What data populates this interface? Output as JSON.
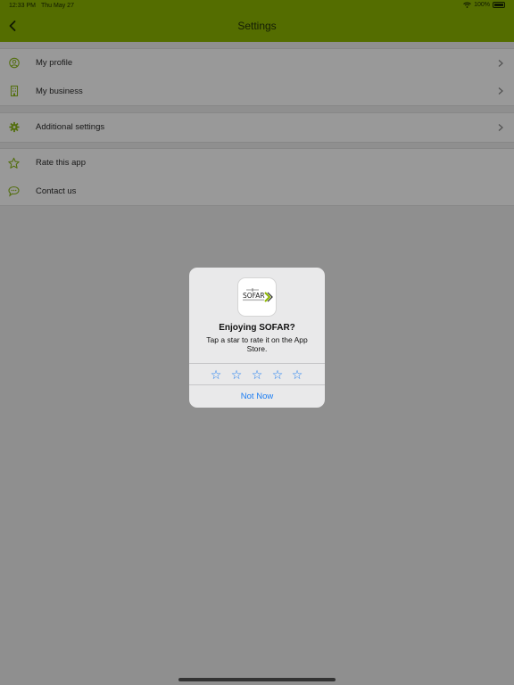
{
  "status_bar": {
    "time": "12:33 PM",
    "date": "Thu May 27",
    "battery": "100%",
    "wifi_icon": "wifi-icon",
    "battery_icon": "battery-icon"
  },
  "nav": {
    "title": "Settings",
    "back_icon": "chevron-left-icon"
  },
  "colors": {
    "brand_green": "#8db600",
    "alert_blue": "#1a7cf2",
    "icon_green": "#8cb91a"
  },
  "settings": {
    "group1": [
      {
        "label": "My profile",
        "icon": "user-circle-icon"
      },
      {
        "label": "My business",
        "icon": "building-icon"
      }
    ],
    "group2": [
      {
        "label": "Additional settings",
        "icon": "gear-icon"
      }
    ],
    "group3": [
      {
        "label": "Rate this app",
        "icon": "star-icon"
      },
      {
        "label": "Contact us",
        "icon": "chat-bubble-icon"
      }
    ]
  },
  "rating_alert": {
    "app_logo_text": "SOFAR",
    "title": "Enjoying SOFAR?",
    "message": "Tap a star to rate it on the App Store.",
    "stars": 5,
    "not_now_label": "Not Now"
  }
}
